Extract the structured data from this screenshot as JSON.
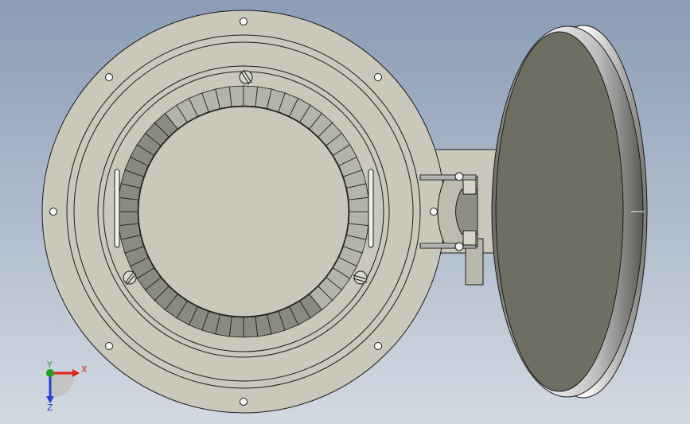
{
  "viewport": {
    "background_top": "#8a9db5",
    "background_bottom": "#d3d9e2"
  },
  "model": {
    "part_color": "#c9c8ba",
    "edge_color": "#1a1a1a",
    "segment_light": "#b4b4aa",
    "segment_dark": "#8a8a80",
    "disc_face": "#6e6f62",
    "disc_rim": "#e8e8e8",
    "bolt_hole_count": 8,
    "segment_count": 56
  },
  "triad": {
    "x_label": "X",
    "y_label": "Y",
    "z_label": "Z",
    "x_color": "#e0201c",
    "y_color": "#1fa01f",
    "z_color": "#2040d8"
  }
}
